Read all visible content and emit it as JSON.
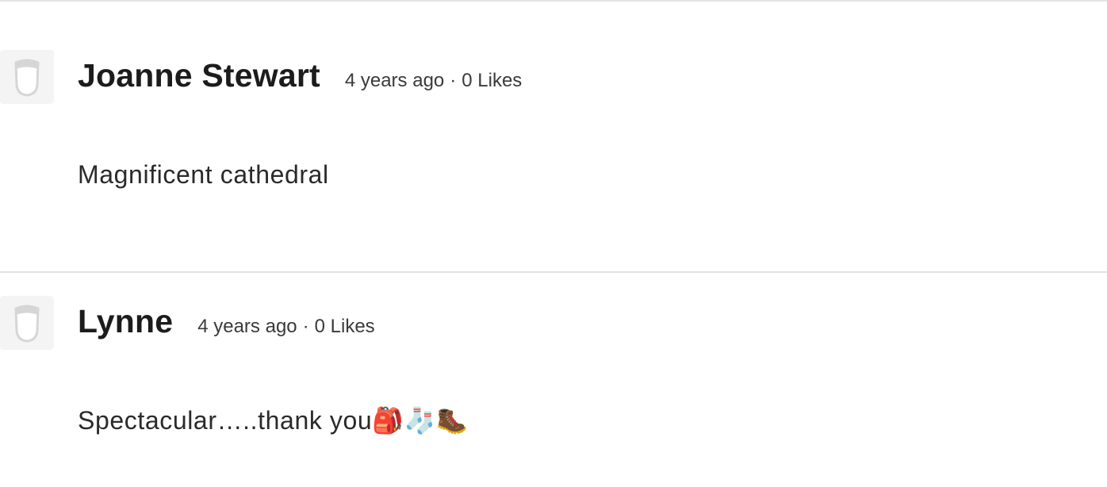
{
  "comments": [
    {
      "author": "Joanne Stewart",
      "time": "4 years ago",
      "separator": "·",
      "likes": "0 Likes",
      "text": "Magnificent cathedral"
    },
    {
      "author": "Lynne",
      "time": "4 years ago",
      "separator": "·",
      "likes": "0 Likes",
      "text": "Spectacular…..thank you🎒🧦🥾"
    }
  ],
  "avatar_icon": "default-user-avatar-icon"
}
